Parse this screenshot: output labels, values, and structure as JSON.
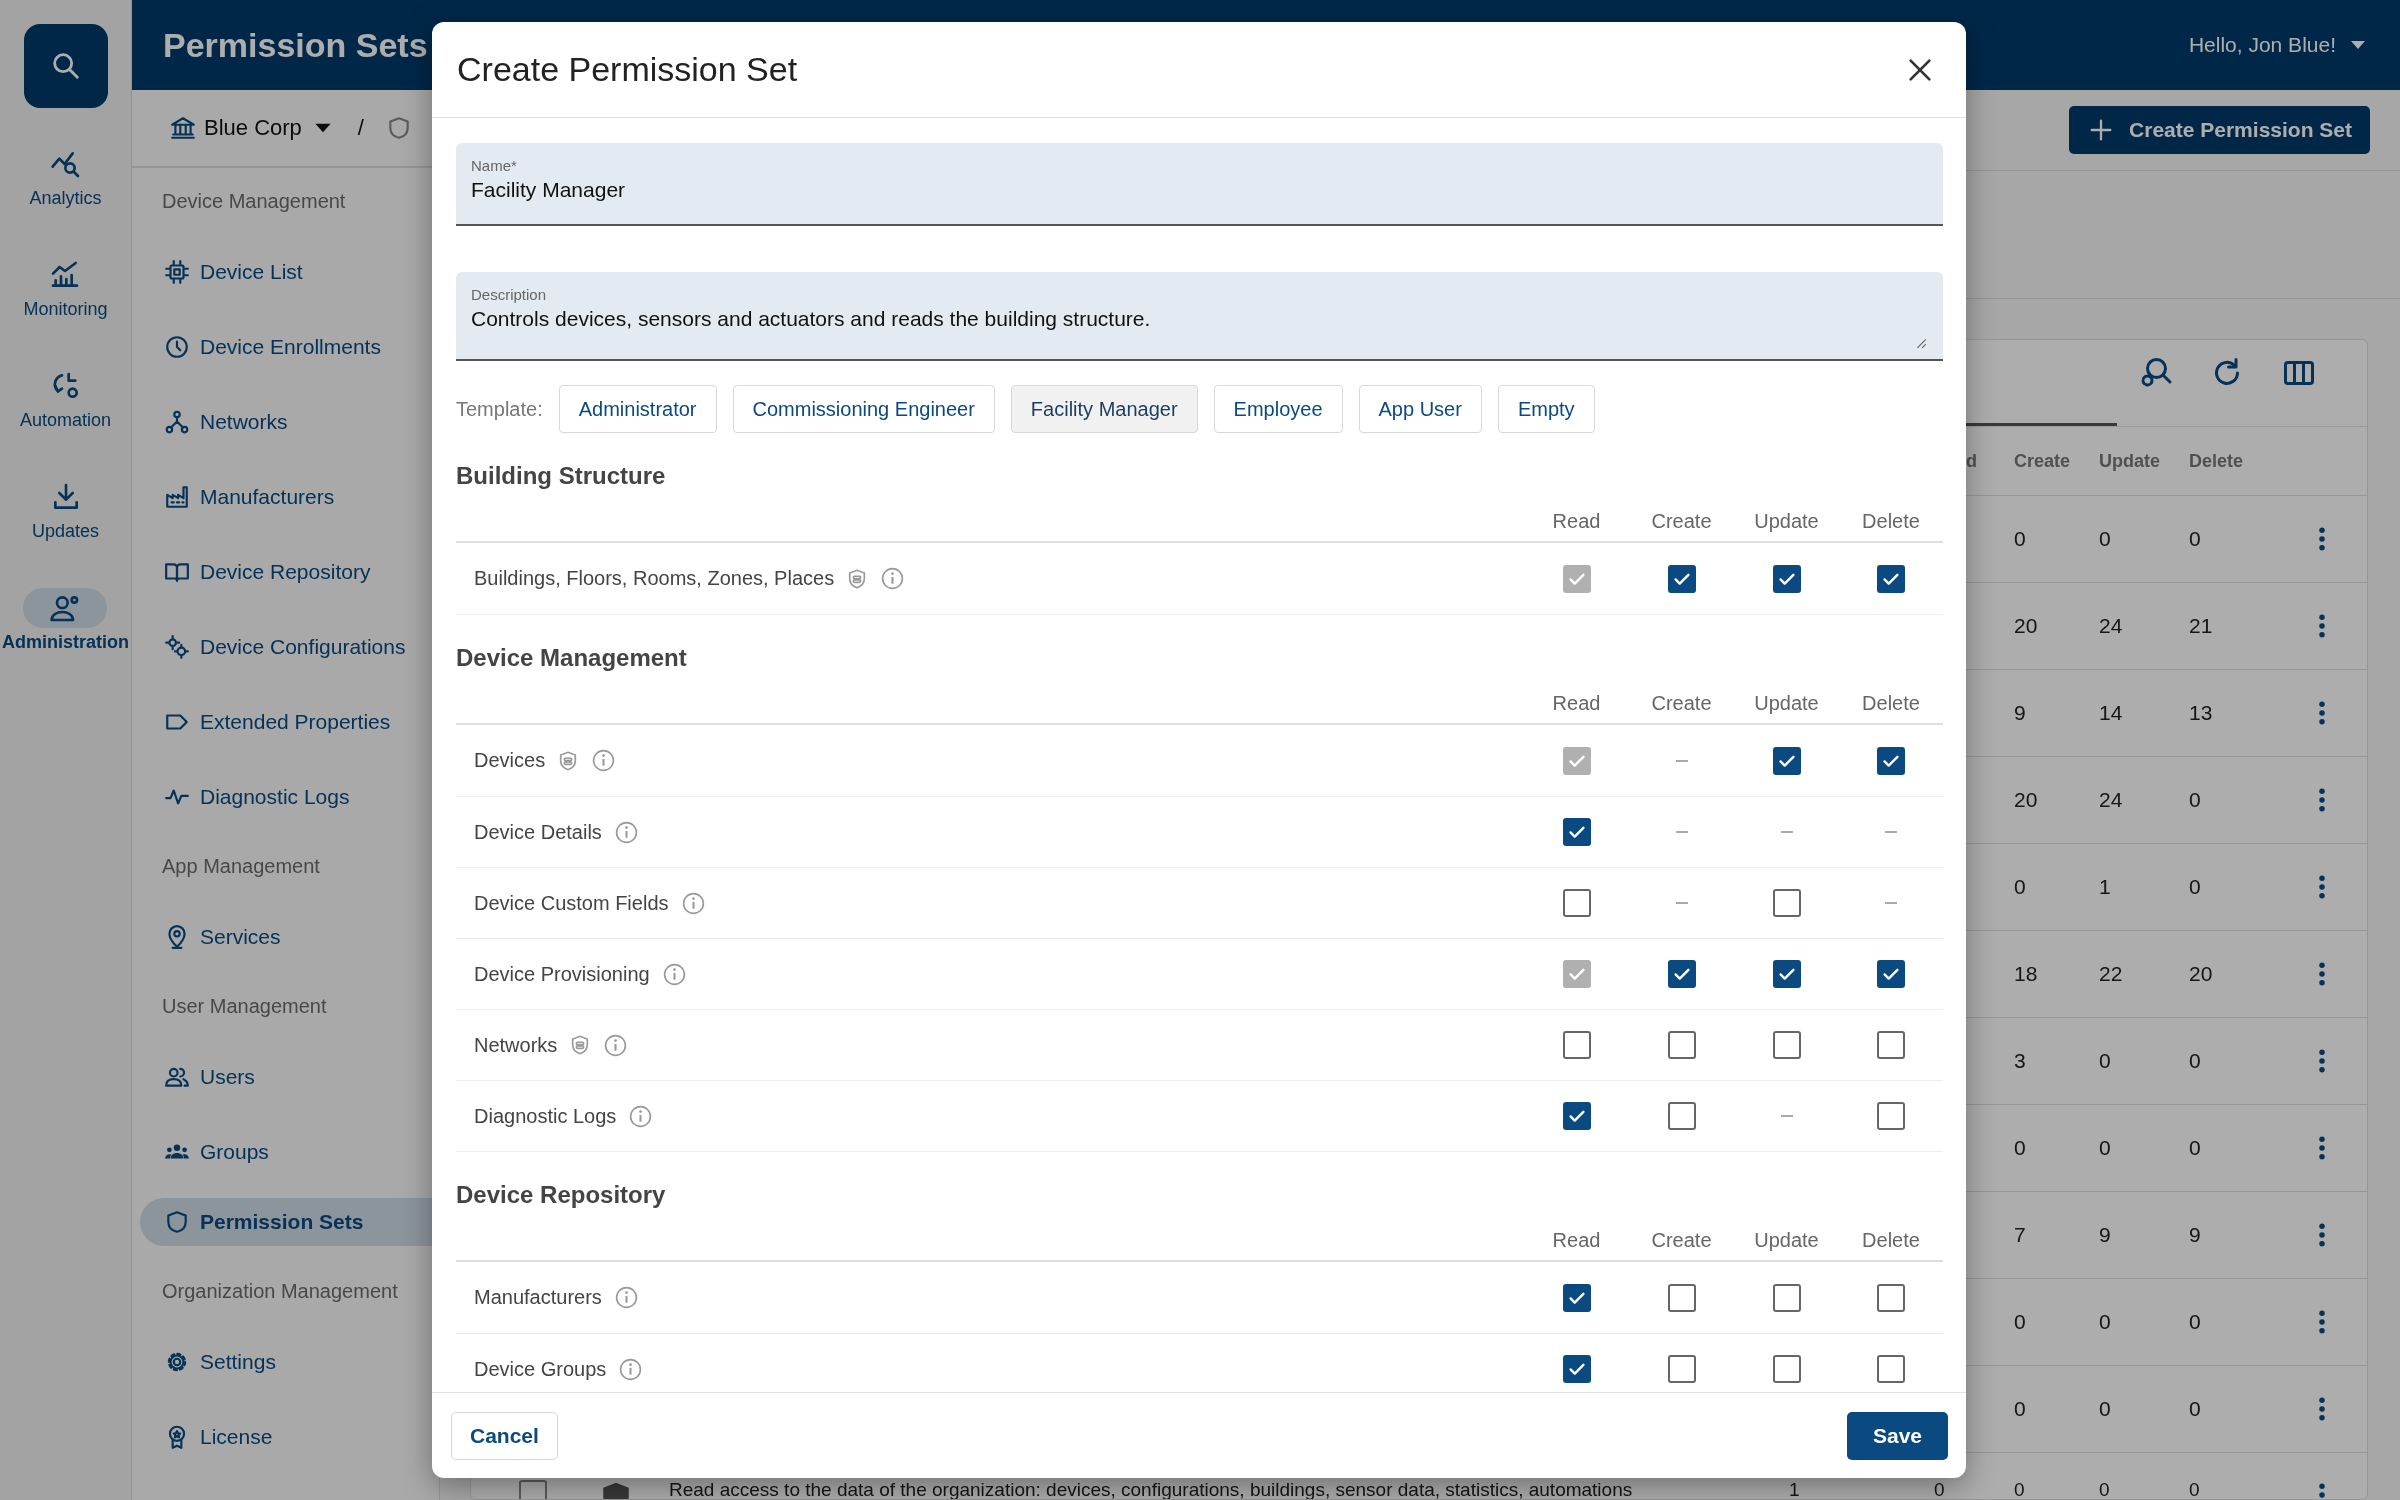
{
  "app_header": {
    "title": "Permission Sets",
    "greeting": "Hello, Jon Blue!"
  },
  "rail": {
    "items": [
      {
        "label": "Analytics",
        "selected": false
      },
      {
        "label": "Monitoring",
        "selected": false
      },
      {
        "label": "Automation",
        "selected": false
      },
      {
        "label": "Updates",
        "selected": false
      },
      {
        "label": "Administration",
        "selected": true
      }
    ]
  },
  "breadcrumb": {
    "organization": "Blue Corp",
    "separator": "/"
  },
  "nav": {
    "groups": [
      {
        "heading": "Device Management",
        "items": [
          {
            "label": "Device List",
            "selected": false
          },
          {
            "label": "Device Enrollments",
            "selected": false
          },
          {
            "label": "Networks",
            "selected": false
          },
          {
            "label": "Manufacturers",
            "selected": false
          },
          {
            "label": "Device Repository",
            "selected": false
          },
          {
            "label": "Device Configurations",
            "selected": false
          },
          {
            "label": "Extended Properties",
            "selected": false
          },
          {
            "label": "Diagnostic Logs",
            "selected": false
          }
        ]
      },
      {
        "heading": "App Management",
        "items": [
          {
            "label": "Services",
            "selected": false
          }
        ]
      },
      {
        "heading": "User Management",
        "items": [
          {
            "label": "Users",
            "selected": false
          },
          {
            "label": "Groups",
            "selected": false
          },
          {
            "label": "Permission Sets",
            "selected": true
          }
        ]
      },
      {
        "heading": "Organization Management",
        "items": [
          {
            "label": "Settings",
            "selected": false
          },
          {
            "label": "License",
            "selected": false
          }
        ]
      }
    ]
  },
  "page_toolbar": {
    "create_button": "Create Permission Set"
  },
  "table": {
    "columns": {
      "read": "d",
      "create": "Create",
      "update": "Update",
      "delete": "Delete"
    },
    "rows": [
      {
        "create": "0",
        "update": "0",
        "delete": "0"
      },
      {
        "create": "20",
        "update": "24",
        "delete": "21"
      },
      {
        "create": "9",
        "update": "14",
        "delete": "13"
      },
      {
        "create": "20",
        "update": "24",
        "delete": "0"
      },
      {
        "create": "0",
        "update": "1",
        "delete": "0"
      },
      {
        "create": "18",
        "update": "22",
        "delete": "20"
      },
      {
        "create": "3",
        "update": "0",
        "delete": "0"
      },
      {
        "create": "0",
        "update": "0",
        "delete": "0"
      },
      {
        "create": "7",
        "update": "9",
        "delete": "9"
      },
      {
        "create": "0",
        "update": "0",
        "delete": "0"
      },
      {
        "create": "0",
        "update": "0",
        "delete": "0"
      },
      {
        "checked": false,
        "description": "Read access to the data of the organization: devices, configurations, buildings, sensor data, statistics, automations",
        "column_a": "1",
        "read": "0",
        "create": "0",
        "update": "0",
        "delete": "0"
      }
    ]
  },
  "dialog": {
    "title": "Create Permission Set",
    "name_field": {
      "label": "Name*",
      "value": "Facility Manager"
    },
    "description_field": {
      "label": "Description",
      "value": "Controls devices, sensors and actuators and reads the building structure."
    },
    "template": {
      "label": "Template:",
      "options": [
        {
          "label": "Administrator",
          "selected": false
        },
        {
          "label": "Commissioning Engineer",
          "selected": false
        },
        {
          "label": "Facility Manager",
          "selected": true
        },
        {
          "label": "Employee",
          "selected": false
        },
        {
          "label": "App User",
          "selected": false
        },
        {
          "label": "Empty",
          "selected": false
        }
      ]
    },
    "sections": [
      {
        "title": "Building Structure",
        "columns": [
          "Read",
          "Create",
          "Update",
          "Delete"
        ],
        "rows": [
          {
            "label": "Buildings, Floors, Rooms, Zones, Places",
            "shield_badge": true,
            "cells": [
              {
                "kind": "checkbox",
                "checked": true,
                "disabled": true
              },
              {
                "kind": "checkbox",
                "checked": true,
                "disabled": false
              },
              {
                "kind": "checkbox",
                "checked": true,
                "disabled": false
              },
              {
                "kind": "checkbox",
                "checked": true,
                "disabled": false
              }
            ]
          }
        ]
      },
      {
        "title": "Device Management",
        "columns": [
          "Read",
          "Create",
          "Update",
          "Delete"
        ],
        "rows": [
          {
            "label": "Devices",
            "shield_badge": true,
            "cells": [
              {
                "kind": "checkbox",
                "checked": true,
                "disabled": true
              },
              {
                "kind": "none"
              },
              {
                "kind": "checkbox",
                "checked": true,
                "disabled": false
              },
              {
                "kind": "checkbox",
                "checked": true,
                "disabled": false
              }
            ]
          },
          {
            "label": "Device Details",
            "shield_badge": false,
            "cells": [
              {
                "kind": "checkbox",
                "checked": true,
                "disabled": false
              },
              {
                "kind": "none"
              },
              {
                "kind": "none"
              },
              {
                "kind": "none"
              }
            ]
          },
          {
            "label": "Device Custom Fields",
            "shield_badge": false,
            "cells": [
              {
                "kind": "checkbox",
                "checked": false,
                "disabled": false
              },
              {
                "kind": "none"
              },
              {
                "kind": "checkbox",
                "checked": false,
                "disabled": false
              },
              {
                "kind": "none"
              }
            ]
          },
          {
            "label": "Device Provisioning",
            "shield_badge": false,
            "cells": [
              {
                "kind": "checkbox",
                "checked": true,
                "disabled": true
              },
              {
                "kind": "checkbox",
                "checked": true,
                "disabled": false
              },
              {
                "kind": "checkbox",
                "checked": true,
                "disabled": false
              },
              {
                "kind": "checkbox",
                "checked": true,
                "disabled": false
              }
            ]
          },
          {
            "label": "Networks",
            "shield_badge": true,
            "cells": [
              {
                "kind": "checkbox",
                "checked": false,
                "disabled": false
              },
              {
                "kind": "checkbox",
                "checked": false,
                "disabled": false
              },
              {
                "kind": "checkbox",
                "checked": false,
                "disabled": false
              },
              {
                "kind": "checkbox",
                "checked": false,
                "disabled": false
              }
            ]
          },
          {
            "label": "Diagnostic Logs",
            "shield_badge": false,
            "cells": [
              {
                "kind": "checkbox",
                "checked": true,
                "disabled": false
              },
              {
                "kind": "checkbox",
                "checked": false,
                "disabled": false
              },
              {
                "kind": "none"
              },
              {
                "kind": "checkbox",
                "checked": false,
                "disabled": false
              }
            ]
          }
        ]
      },
      {
        "title": "Device Repository",
        "columns": [
          "Read",
          "Create",
          "Update",
          "Delete"
        ],
        "rows": [
          {
            "label": "Manufacturers",
            "shield_badge": false,
            "cells": [
              {
                "kind": "checkbox",
                "checked": true,
                "disabled": false
              },
              {
                "kind": "checkbox",
                "checked": false,
                "disabled": false
              },
              {
                "kind": "checkbox",
                "checked": false,
                "disabled": false
              },
              {
                "kind": "checkbox",
                "checked": false,
                "disabled": false
              }
            ]
          },
          {
            "label": "Device Groups",
            "shield_badge": false,
            "cells": [
              {
                "kind": "checkbox",
                "checked": true,
                "disabled": false
              },
              {
                "kind": "checkbox",
                "checked": false,
                "disabled": false
              },
              {
                "kind": "checkbox",
                "checked": false,
                "disabled": false
              },
              {
                "kind": "checkbox",
                "checked": false,
                "disabled": false
              }
            ]
          }
        ]
      }
    ],
    "cancel_button": "Cancel",
    "save_button": "Save"
  }
}
